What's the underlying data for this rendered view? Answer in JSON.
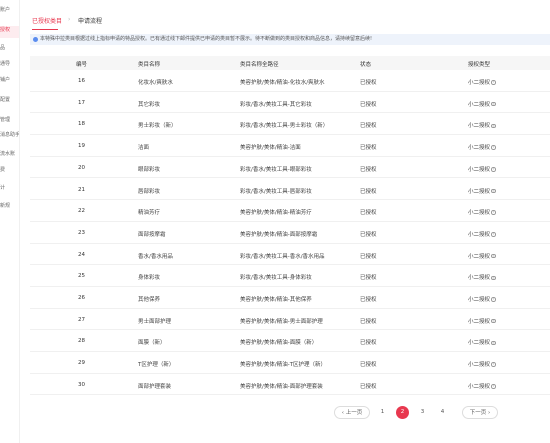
{
  "sidebar": {
    "items": [
      {
        "label": "账户",
        "active": false
      },
      {
        "label": "授权",
        "active": true
      },
      {
        "label": "品",
        "active": false
      },
      {
        "label": "通导",
        "active": false
      },
      {
        "label": "铺户",
        "active": false
      },
      {
        "label": "配置",
        "active": false
      },
      {
        "label": "管理",
        "active": false
      },
      {
        "label": "消息助手",
        "active": false
      },
      {
        "label": "流水账",
        "active": false
      },
      {
        "label": "费",
        "active": false
      },
      {
        "label": "计",
        "active": false
      },
      {
        "label": "新规",
        "active": false
      }
    ]
  },
  "tabs": [
    {
      "label": "已授权类目",
      "active": true
    },
    {
      "label": "申请流程",
      "active": false
    }
  ],
  "tab_separator": "›",
  "notice": {
    "text": "本特殊中拉类目根据过线上指标申请的特品授权。已有通过线下邮件提供已申请的类目暂不展示。待不断做到的类目授权和商品信息，请持续留意后续!"
  },
  "table": {
    "columns": [
      "编号",
      "类目名称",
      "类目名称全路径",
      "状态",
      "授权类型"
    ],
    "rows": [
      {
        "id": "16",
        "name": "化妆水/爽肤水",
        "path": "美容护肤/美体/精油-化妆水/爽肤水",
        "status": "已授权",
        "type": "小二授权"
      },
      {
        "id": "17",
        "name": "其它彩妆",
        "path": "彩妆/香水/美妆工具-其它彩妆",
        "status": "已授权",
        "type": "小二授权"
      },
      {
        "id": "18",
        "name": "男士彩妆（新）",
        "path": "彩妆/香水/美妆工具-男士彩妆（新）",
        "status": "已授权",
        "type": "小二授权"
      },
      {
        "id": "19",
        "name": "洁面",
        "path": "美容护肤/美体/精油-洁面",
        "status": "已授权",
        "type": "小二授权"
      },
      {
        "id": "20",
        "name": "眼部彩妆",
        "path": "彩妆/香水/美妆工具-眼部彩妆",
        "status": "已授权",
        "type": "小二授权"
      },
      {
        "id": "21",
        "name": "唇部彩妆",
        "path": "彩妆/香水/美妆工具-唇部彩妆",
        "status": "已授权",
        "type": "小二授权"
      },
      {
        "id": "22",
        "name": "精油芳疗",
        "path": "美容护肤/美体/精油-精油芳疗",
        "status": "已授权",
        "type": "小二授权"
      },
      {
        "id": "23",
        "name": "面部按摩霜",
        "path": "美容护肤/美体/精油-面部按摩霜",
        "status": "已授权",
        "type": "小二授权"
      },
      {
        "id": "24",
        "name": "香水/香水用品",
        "path": "彩妆/香水/美妆工具-香水/香水用品",
        "status": "已授权",
        "type": "小二授权"
      },
      {
        "id": "25",
        "name": "身体彩妆",
        "path": "彩妆/香水/美妆工具-身体彩妆",
        "status": "已授权",
        "type": "小二授权"
      },
      {
        "id": "26",
        "name": "其他保养",
        "path": "美容护肤/美体/精油-其他保养",
        "status": "已授权",
        "type": "小二授权"
      },
      {
        "id": "27",
        "name": "男士面部护理",
        "path": "美容护肤/美体/精油-男士面部护理",
        "status": "已授权",
        "type": "小二授权"
      },
      {
        "id": "28",
        "name": "面膜（新）",
        "path": "美容护肤/美体/精油-面膜（新）",
        "status": "已授权",
        "type": "小二授权"
      },
      {
        "id": "29",
        "name": "T区护理（新）",
        "path": "美容护肤/美体/精油-T区护理（新）",
        "status": "已授权",
        "type": "小二授权"
      },
      {
        "id": "30",
        "name": "面部护理套装",
        "path": "美容护肤/美体/精油-面部护理套装",
        "status": "已授权",
        "type": "小二授权"
      }
    ]
  },
  "pagination": {
    "prev_label": "‹ 上一页",
    "next_label": "下一页 ›",
    "pages": [
      "1",
      "2",
      "3",
      "4"
    ],
    "current": "2"
  },
  "colors": {
    "accent": "#e8384f",
    "notice_bg": "#eef3fb"
  }
}
